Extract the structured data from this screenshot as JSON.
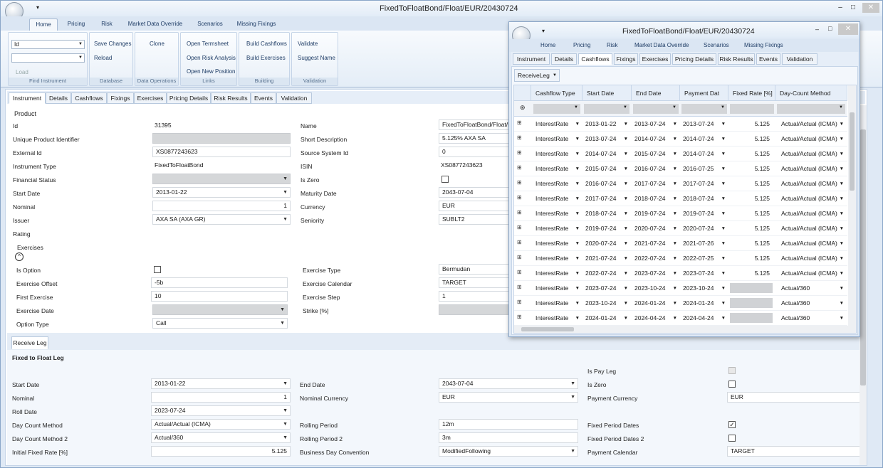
{
  "main_window": {
    "title": "FixedToFloatBond/Float/EUR/20430724",
    "buttons": {
      "minimize": "–",
      "maximize": "□",
      "close": "✕"
    }
  },
  "ribbon_tabs": [
    "Home",
    "Pricing",
    "Risk",
    "Market Data Override",
    "Scenarios",
    "Missing Fixings"
  ],
  "ribbon": {
    "find_instrument": {
      "combo1": "Id",
      "combo2": "",
      "load": "Load",
      "caption": "Find Instrument"
    },
    "database": {
      "save": "Save Changes",
      "reload": "Reload",
      "caption": "Database"
    },
    "data_operations": {
      "clone": "Clone",
      "caption": "Data Operations"
    },
    "links": {
      "termsheet": "Open Termsheet",
      "risk": "Open Risk Analysis",
      "position": "Open New Position",
      "caption": "Links"
    },
    "building": {
      "cashflows": "Build Cashflows",
      "exercises": "Build Exercises",
      "caption": "Building"
    },
    "validation": {
      "validate": "Validate",
      "suggest": "Suggest Name",
      "caption": "Validation"
    }
  },
  "doc_tabs": [
    "Instrument",
    "Details",
    "Cashflows",
    "Fixings",
    "Exercises",
    "Pricing Details",
    "Risk Results",
    "Events",
    "Validation"
  ],
  "product": {
    "heading": "Product",
    "id_label": "Id",
    "id": "31395",
    "upi_label": "Unique Product Identifier",
    "ext_label": "External Id",
    "ext": "XS0877243623",
    "type_label": "Instrument Type",
    "type": "FixedToFloatBond",
    "status_label": "Financial Status",
    "start_label": "Start Date",
    "start": "2013-01-22",
    "nominal_label": "Nominal",
    "nominal": "1",
    "issuer_label": "Issuer",
    "issuer": "AXA SA (AXA GR)",
    "rating_label": "Rating",
    "name_label": "Name",
    "name": "FixedToFloatBond/Float/EUR/20430724",
    "short_label": "Short Description",
    "short": "5.125% AXA SA",
    "src_label": "Source System Id",
    "src": "0",
    "isin_label": "ISIN",
    "isin": "XS0877243623",
    "iszero_label": "Is Zero",
    "maturity_label": "Maturity Date",
    "maturity": "2043-07-04",
    "currency_label": "Currency",
    "currency": "EUR",
    "seniority_label": "Seniority",
    "seniority": "SUBLT2"
  },
  "exercises": {
    "heading": "Exercises",
    "isoption_label": "Is Option",
    "offset_label": "Exercise Offset",
    "offset": "-5b",
    "first_label": "First Exercise",
    "first": "10",
    "date_label": "Exercise Date",
    "opttype_label": "Option Type",
    "opttype": "Call",
    "type_label": "Exercise Type",
    "type": "Bermudan",
    "cal_label": "Exercise Calendar",
    "cal": "TARGET",
    "step_label": "Exercise Step",
    "step": "1",
    "strike_label": "Strike [%]"
  },
  "leg_tab": "Receive Leg",
  "leg": {
    "heading": "Fixed to Float Leg",
    "start_label": "Start Date",
    "start": "2013-01-22",
    "nominal_label": "Nominal",
    "nominal": "1",
    "roll_label": "Roll Date",
    "roll": "2023-07-24",
    "dcm_label": "Day Count Method",
    "dcm": "Actual/Actual (ICMA)",
    "dcm2_label": "Day Count Method 2",
    "dcm2": "Actual/360",
    "ifr_label": "Initial Fixed Rate [%]",
    "ifr": "5.125",
    "end_label": "End Date",
    "end": "2043-07-04",
    "ncur_label": "Nominal Currency",
    "ncur": "EUR",
    "rp_label": "Rolling Period",
    "rp": "12m",
    "rp2_label": "Rolling Period 2",
    "rp2": "3m",
    "bdc_label": "Business Day Convention",
    "bdc": "ModifiedFollowing",
    "pay_label": "Is Pay Leg",
    "zero_label": "Is Zero",
    "pcur_label": "Payment Currency",
    "pcur": "EUR",
    "fpd_label": "Fixed Period Dates",
    "fpd2_label": "Fixed Period Dates 2",
    "pcal_label": "Payment Calendar",
    "pcal": "TARGET"
  },
  "popup": {
    "title": "FixedToFloatBond/Float/EUR/20430724",
    "ribbon_tabs": [
      "Home",
      "Pricing",
      "Risk",
      "Market Data Override",
      "Scenarios",
      "Missing Fixings"
    ],
    "doc_tabs": [
      "Instrument",
      "Details",
      "Cashflows",
      "Fixings",
      "Exercises",
      "Pricing Details",
      "Risk Results",
      "Events",
      "Validation"
    ],
    "leg_selector": "ReceiveLeg",
    "columns": [
      "Cashflow Type",
      "Start Date",
      "End Date",
      "Payment Dat",
      "Fixed Rate [%]",
      "Day-Count Method"
    ],
    "rows": [
      [
        "InterestRate",
        "2013-01-22",
        "2013-07-24",
        "2013-07-24",
        "5.125",
        "Actual/Actual (ICMA)"
      ],
      [
        "InterestRate",
        "2013-07-24",
        "2014-07-24",
        "2014-07-24",
        "5.125",
        "Actual/Actual (ICMA)"
      ],
      [
        "InterestRate",
        "2014-07-24",
        "2015-07-24",
        "2014-07-24",
        "5.125",
        "Actual/Actual (ICMA)"
      ],
      [
        "InterestRate",
        "2015-07-24",
        "2016-07-24",
        "2016-07-25",
        "5.125",
        "Actual/Actual (ICMA)"
      ],
      [
        "InterestRate",
        "2016-07-24",
        "2017-07-24",
        "2017-07-24",
        "5.125",
        "Actual/Actual (ICMA)"
      ],
      [
        "InterestRate",
        "2017-07-24",
        "2018-07-24",
        "2018-07-24",
        "5.125",
        "Actual/Actual (ICMA)"
      ],
      [
        "InterestRate",
        "2018-07-24",
        "2019-07-24",
        "2019-07-24",
        "5.125",
        "Actual/Actual (ICMA)"
      ],
      [
        "InterestRate",
        "2019-07-24",
        "2020-07-24",
        "2020-07-24",
        "5.125",
        "Actual/Actual (ICMA)"
      ],
      [
        "InterestRate",
        "2020-07-24",
        "2021-07-24",
        "2021-07-26",
        "5.125",
        "Actual/Actual (ICMA)"
      ],
      [
        "InterestRate",
        "2021-07-24",
        "2022-07-24",
        "2022-07-25",
        "5.125",
        "Actual/Actual (ICMA)"
      ],
      [
        "InterestRate",
        "2022-07-24",
        "2023-07-24",
        "2023-07-24",
        "5.125",
        "Actual/Actual (ICMA)"
      ],
      [
        "InterestRate",
        "2023-07-24",
        "2023-10-24",
        "2023-10-24",
        "",
        "Actual/360"
      ],
      [
        "InterestRate",
        "2023-10-24",
        "2024-01-24",
        "2024-01-24",
        "",
        "Actual/360"
      ],
      [
        "InterestRate",
        "2024-01-24",
        "2024-04-24",
        "2024-04-24",
        "",
        "Actual/360"
      ]
    ]
  }
}
